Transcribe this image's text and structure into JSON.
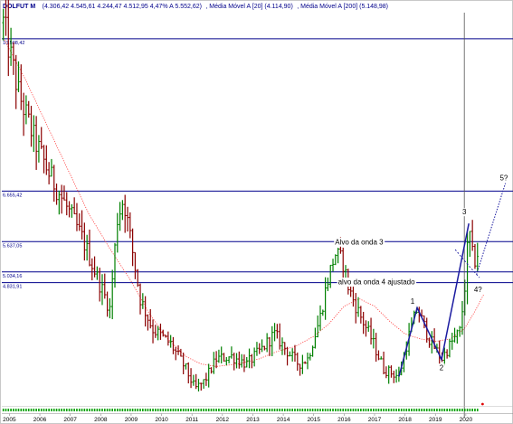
{
  "header": {
    "symbol": "DOLFUT M",
    "ohlc": "(4.306,42  4.545,61  4.244,47  4.512,95  4,47%  A 5.552,62)",
    "ma20": ", Média Móvel A [20] (4.114,90)",
    "ma200": ", Média Móvel A [200] (5.148,98)"
  },
  "chart_data": {
    "type": "candlestick",
    "title": "DOLFUT M",
    "x_ticks": [
      "2005",
      "2006",
      "2007",
      "2008",
      "2009",
      "2010",
      "2011",
      "2012",
      "2013",
      "2014",
      "2015",
      "2016",
      "2017",
      "2018",
      "2019",
      "2020"
    ],
    "xlim": [
      2004.75,
      2021.55
    ],
    "ylim": [
      2400,
      10200
    ],
    "level_labels": [
      "10.508,42",
      "6.655,42",
      "5.637,05",
      "5.034,16",
      "4.831,91"
    ],
    "horizontal_levels": [
      {
        "value": 9680,
        "label": "10.508,42"
      },
      {
        "value": 6645,
        "label": "6.655,42"
      },
      {
        "value": 5637,
        "label": "5.637,05"
      },
      {
        "value": 5034,
        "label": "5.034,16"
      },
      {
        "value": 4820,
        "label": "4.831,91"
      }
    ],
    "annotations": [
      {
        "text": "Alvo da onda 3",
        "x": 2015.7,
        "y": 5637
      },
      {
        "text": "alvo da onda 4 ajustado",
        "x": 2015.8,
        "y": 4840
      }
    ],
    "wave_labels": [
      {
        "text": "1",
        "x": 2018.25,
        "y": 4400
      },
      {
        "text": "2",
        "x": 2019.2,
        "y": 3080
      },
      {
        "text": "3",
        "x": 2019.95,
        "y": 6180
      },
      {
        "text": "4?",
        "x": 2020.4,
        "y": 4630
      },
      {
        "text": "5?",
        "x": 2021.25,
        "y": 6860
      }
    ],
    "wave_path": [
      [
        2017.8,
        2950
      ],
      [
        2018.4,
        4320
      ],
      [
        2019.2,
        3290
      ],
      [
        2020.1,
        6000
      ]
    ],
    "projection_path": [
      [
        2020.35,
        4980
      ],
      [
        2021.3,
        6800
      ]
    ],
    "corrective_path": [
      [
        2019.65,
        5480
      ],
      [
        2020.15,
        5120
      ],
      [
        2020.45,
        4920
      ]
    ],
    "cursor_x": 2019.95,
    "price_key_points": [
      [
        2004.8,
        10000
      ],
      [
        2005.3,
        8600
      ],
      [
        2005.8,
        7700
      ],
      [
        2006.3,
        7000
      ],
      [
        2006.9,
        6300
      ],
      [
        2007.4,
        5700
      ],
      [
        2007.9,
        4900
      ],
      [
        2008.3,
        4300
      ],
      [
        2008.55,
        6100
      ],
      [
        2008.75,
        6500
      ],
      [
        2008.95,
        5800
      ],
      [
        2009.3,
        4500
      ],
      [
        2009.7,
        3900
      ],
      [
        2010.3,
        3600
      ],
      [
        2010.8,
        3100
      ],
      [
        2011.1,
        2700
      ],
      [
        2011.4,
        2850
      ],
      [
        2011.8,
        3300
      ],
      [
        2012.3,
        3350
      ],
      [
        2012.8,
        3200
      ],
      [
        2013.3,
        3500
      ],
      [
        2013.7,
        3800
      ],
      [
        2014.2,
        3400
      ],
      [
        2014.5,
        3200
      ],
      [
        2014.8,
        3300
      ],
      [
        2015.2,
        4100
      ],
      [
        2015.45,
        4850
      ],
      [
        2015.7,
        5400
      ],
      [
        2015.95,
        5250
      ],
      [
        2016.15,
        4700
      ],
      [
        2016.5,
        4200
      ],
      [
        2016.9,
        3700
      ],
      [
        2017.3,
        3100
      ],
      [
        2017.8,
        2950
      ],
      [
        2018.1,
        3700
      ],
      [
        2018.4,
        4300
      ],
      [
        2018.8,
        3700
      ],
      [
        2019.2,
        3300
      ],
      [
        2019.5,
        3600
      ],
      [
        2019.8,
        3850
      ],
      [
        2019.95,
        4600
      ],
      [
        2020.1,
        5900
      ],
      [
        2020.25,
        5200
      ],
      [
        2020.45,
        5500
      ]
    ],
    "ma_key_points": [
      [
        2004.8,
        9700
      ],
      [
        2005.5,
        8900
      ],
      [
        2006.2,
        8000
      ],
      [
        2006.9,
        7100
      ],
      [
        2007.6,
        6200
      ],
      [
        2008.3,
        5500
      ],
      [
        2009.0,
        4850
      ],
      [
        2009.6,
        4200
      ],
      [
        2010.2,
        3700
      ],
      [
        2010.8,
        3350
      ],
      [
        2011.3,
        3200
      ],
      [
        2011.8,
        3150
      ],
      [
        2012.5,
        3200
      ],
      [
        2013.2,
        3300
      ],
      [
        2013.8,
        3450
      ],
      [
        2014.4,
        3550
      ],
      [
        2015.0,
        3750
      ],
      [
        2015.5,
        4000
      ],
      [
        2016.0,
        4350
      ],
      [
        2016.5,
        4500
      ],
      [
        2017.0,
        4350
      ],
      [
        2017.5,
        4050
      ],
      [
        2018.0,
        3800
      ],
      [
        2018.5,
        3700
      ],
      [
        2019.0,
        3650
      ],
      [
        2019.5,
        3700
      ],
      [
        2019.95,
        3900
      ],
      [
        2020.3,
        4250
      ],
      [
        2020.6,
        4600
      ]
    ],
    "colors": {
      "up": "#008000",
      "down": "#8b0000",
      "moving_average": "#ff3c3c",
      "level_lines": "#00008b",
      "wave": "#1a1aa0",
      "volume": "#00a000",
      "cursor": "#555555"
    }
  }
}
